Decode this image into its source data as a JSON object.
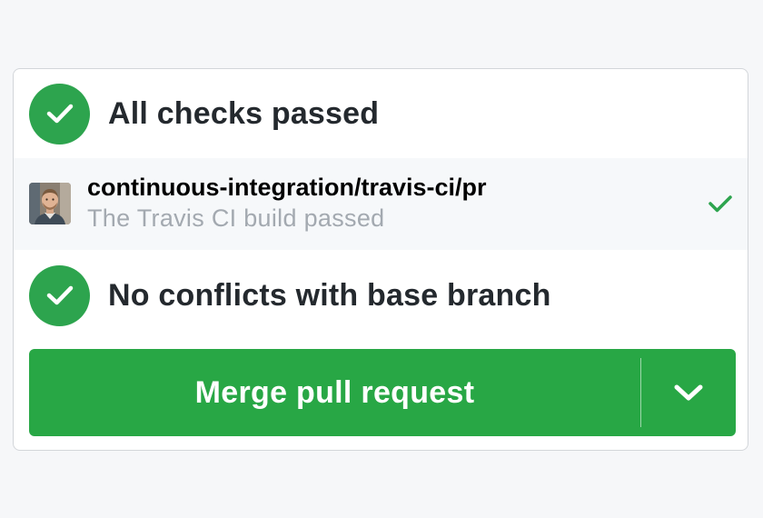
{
  "checks": {
    "title": "All checks passed",
    "status_icon": "checkmark-icon",
    "status_color": "#2da44e"
  },
  "ci": {
    "name": "continuous-integration/travis-ci/pr",
    "description": "The Travis CI build passed",
    "avatar": "avatar-image",
    "status_icon": "checkmark-icon",
    "status_color": "#2da44e",
    "background": "#f6f8fa"
  },
  "conflicts": {
    "title": "No conflicts with base branch",
    "status_icon": "checkmark-icon",
    "status_color": "#2da44e"
  },
  "merge": {
    "label": "Merge pull request",
    "button_color": "#28a745",
    "dropdown_icon": "chevron-down-icon"
  }
}
